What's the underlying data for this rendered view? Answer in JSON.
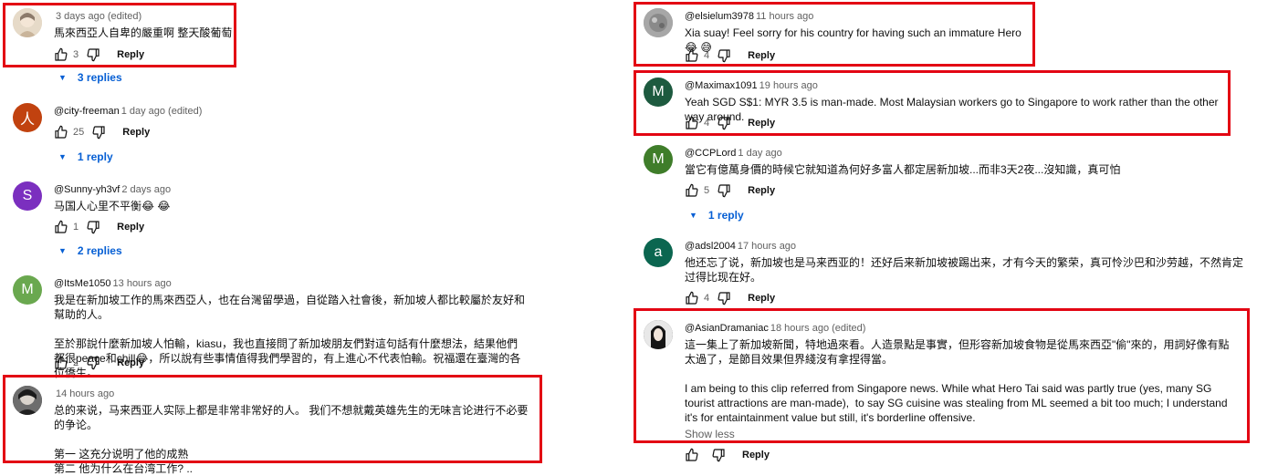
{
  "comments": [
    {
      "handle": "",
      "time": "3 days ago (edited)",
      "text": "馬來西亞人自卑的嚴重啊 整天酸葡萄",
      "likes": "3",
      "reply": "Reply",
      "replies": "3 replies"
    },
    {
      "handle": "@city-freeman",
      "time": "1 day ago (edited)",
      "text": "",
      "likes": "25",
      "reply": "Reply",
      "replies": "1 reply",
      "avatar_letter": "人"
    },
    {
      "handle": "@Sunny-yh3vf",
      "time": "2 days ago",
      "text": "马国人心里不平衡😂 😂",
      "likes": "1",
      "reply": "Reply",
      "replies": "2 replies",
      "avatar_letter": "S"
    },
    {
      "handle": "@ItsMe1050",
      "time": "13 hours ago",
      "text": "我是在新加坡工作的馬來西亞人，也在台灣留學過，自從踏入社會後，新加坡人都比較屬於友好和幫助的人。\n\n至於那說什麼新加坡人怕輸，kiasu，我也直接問了新加坡朋友們對這句話有什麼想法，結果他們都很peace和chill😂，所以說有些事情值得我們學習的，有上進心不代表怕輸。祝福還在臺灣的各位僑生。",
      "likes": "2",
      "reply": "Reply",
      "avatar_letter": "M"
    },
    {
      "handle": "",
      "time": "14 hours ago",
      "text": "总的来说，马来西亚人实际上都是非常非常好的人。 我们不想就戴英雄先生的无味言论进行不必要的争论。\n\n第一 这充分说明了他的成熟\n第二 他为什么在台湾工作? .."
    },
    {
      "handle": "@elsielum3978",
      "time": "11 hours ago",
      "text": "Xia suay! Feel sorry for his country for having such an immature Hero😂 😅",
      "likes": "4",
      "reply": "Reply"
    },
    {
      "handle": "@Maximax1091",
      "time": "19 hours ago",
      "text": "Yeah SGD S$1: MYR 3.5 is man-made. Most Malaysian workers go to Singapore to work rather than the other way around.",
      "likes": "4",
      "reply": "Reply",
      "avatar_letter": "M"
    },
    {
      "handle": "@CCPLord",
      "time": "1 day ago",
      "text": "當它有億萬身價的時候它就知道為何好多富人都定居新加坡...而非3天2夜...沒知識，真可怕",
      "likes": "5",
      "reply": "Reply",
      "replies": "1 reply",
      "avatar_letter": "M"
    },
    {
      "handle": "@adsl2004",
      "time": "17 hours ago",
      "text": "他还忘了说，新加坡也是马来西亚的！还好后来新加坡被踢出来，才有今天的繁荣，真可怜沙巴和沙劳越，不然肯定过得比现在好。",
      "likes": "4",
      "reply": "Reply",
      "avatar_letter": "a"
    },
    {
      "handle": "@AsianDramaniac",
      "time": "18 hours ago (edited)",
      "text": "這一集上了新加坡新聞，特地過來看。人造景點是事實，但形容新加坡食物是從馬來西亞\"偷\"來的，用詞好像有點太過了，是節目效果但界綫沒有拿捏得當。\n\nI am being to this clip referred from Singapore news. While what Hero Tai said was partly true (yes, many SG tourist attractions are man-made),  to say SG cuisine was stealing from ML seemed a bit too much; I understand it's for entaintainment value but still, it's borderline offensive.",
      "likes": "",
      "reply": "Reply",
      "show_less": "Show less"
    }
  ],
  "colors": {
    "highlight": "#e30613",
    "link": "#065fd4",
    "avatar_cityfreeman": "#c1420f",
    "avatar_sunny": "#7b2fbf",
    "avatar_itsme": "#6aa84f",
    "avatar_maximax": "#1d5a3f",
    "avatar_ccplord": "#3f7d2a",
    "avatar_adsl": "#0b6650"
  }
}
